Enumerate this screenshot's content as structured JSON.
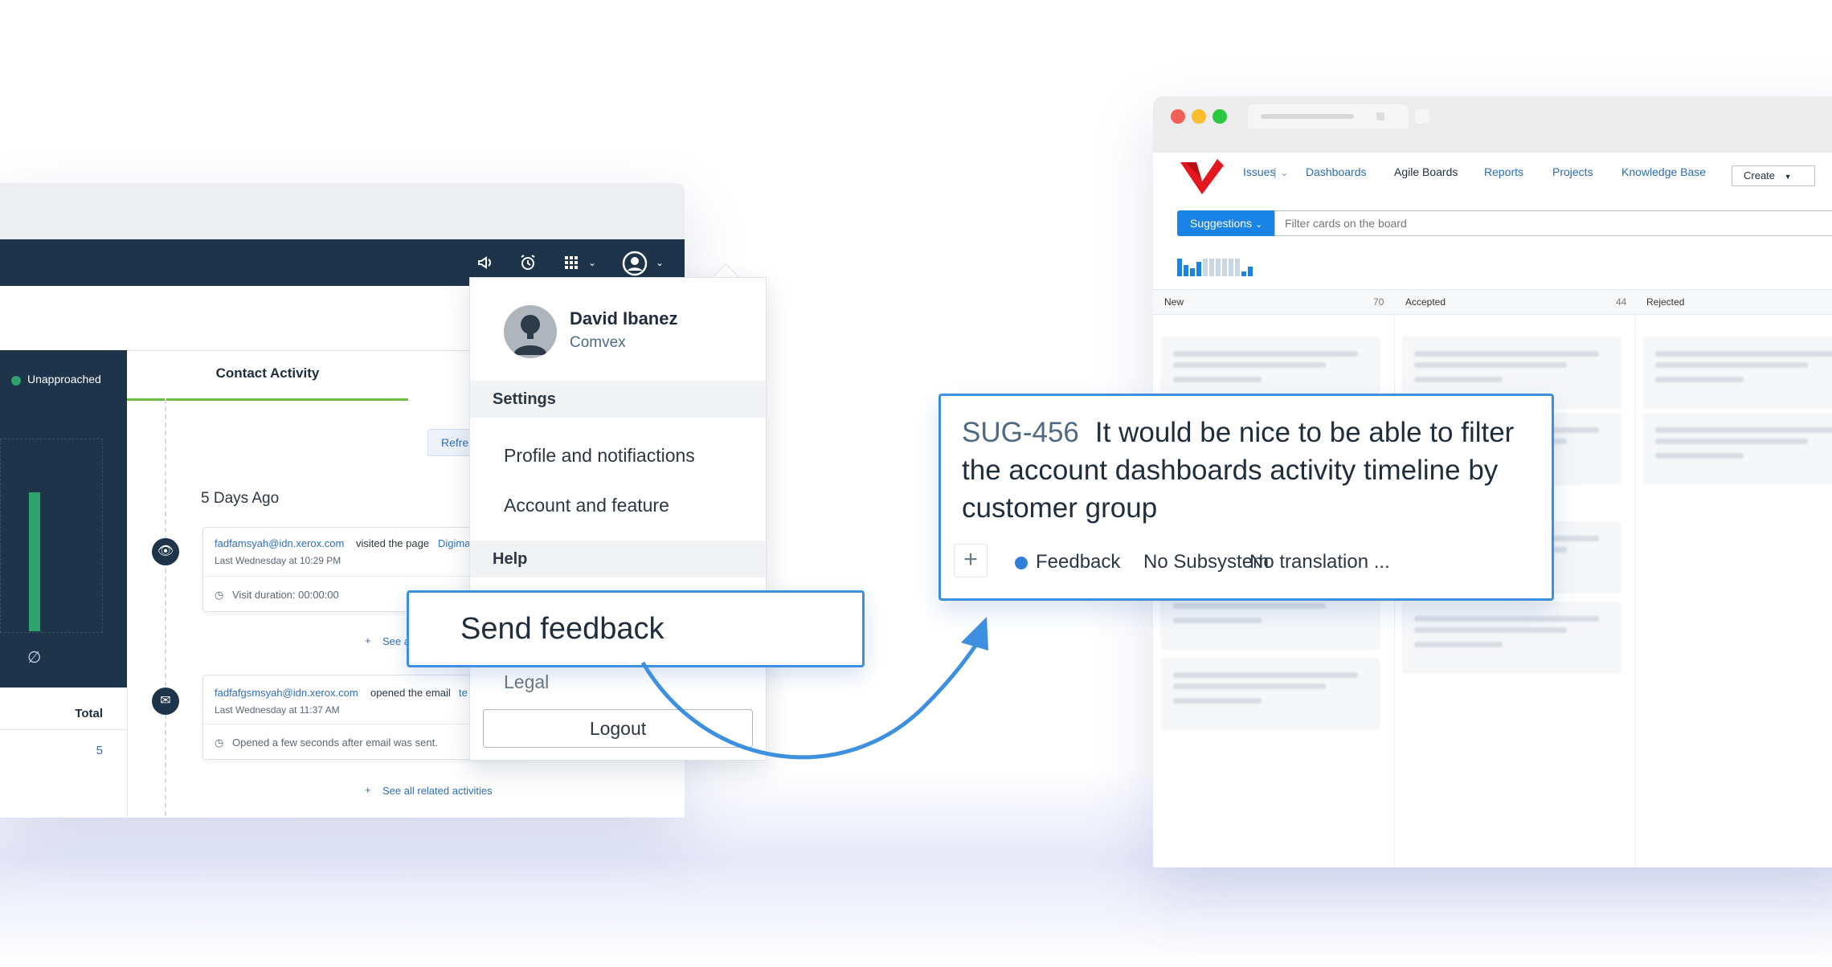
{
  "left_app": {
    "sidebar_status": "Unapproached",
    "tab_label": "Contact Activity",
    "refresh_label": "Refre",
    "date_header": "5 Days Ago",
    "activity_1": {
      "email": "fadfamsyah@idn.xerox.com",
      "action": "visited the page",
      "link": "Digima",
      "time": "Last Wednesday at 10:29 PM",
      "detail": "Visit duration: 00:00:00"
    },
    "see_more_partial": "See a",
    "activity_2": {
      "email": "fadfafgsmsyah@idn.xerox.com",
      "action": "opened the email",
      "link": "te",
      "time": "Last Wednesday at 11:37 AM",
      "detail": "Opened a few seconds after email was sent."
    },
    "see_all": "See all related activities",
    "total_label": "Total",
    "total_value": "5",
    "chart_bar_level": 0.72
  },
  "user_menu": {
    "name": "David Ibanez",
    "company": "Comvex",
    "settings_header": "Settings",
    "items_settings": [
      "Profile and notifiactions",
      "Account and feature"
    ],
    "help_header": "Help",
    "legal_label": "Legal",
    "send_feedback": "Send feedback",
    "logout": "Logout"
  },
  "right_app": {
    "nav": [
      "Issues",
      "Dashboards",
      "Agile Boards",
      "Reports",
      "Projects",
      "Knowledge Base"
    ],
    "create_label": "Create",
    "board_select": "Suggestions",
    "filter_placeholder": "Filter cards on the board",
    "columns": [
      {
        "name": "New",
        "count": "70"
      },
      {
        "name": "Accepted",
        "count": "44"
      },
      {
        "name": "Rejected",
        "count": ""
      }
    ]
  },
  "issue_card": {
    "id": "SUG-456",
    "summary": "It would be nice to be able to filter the account dashboards activity timeline by customer group",
    "type": "Feedback",
    "subsystem": "No Subsystem",
    "translation": "No translation ..."
  },
  "colors": {
    "accent": "#3d8fe0",
    "nav_dark": "#1d344a",
    "progress_green": "#2fa36b",
    "feedback_dot": "#2f7fd6",
    "youtrack_red": "#e4161e"
  }
}
